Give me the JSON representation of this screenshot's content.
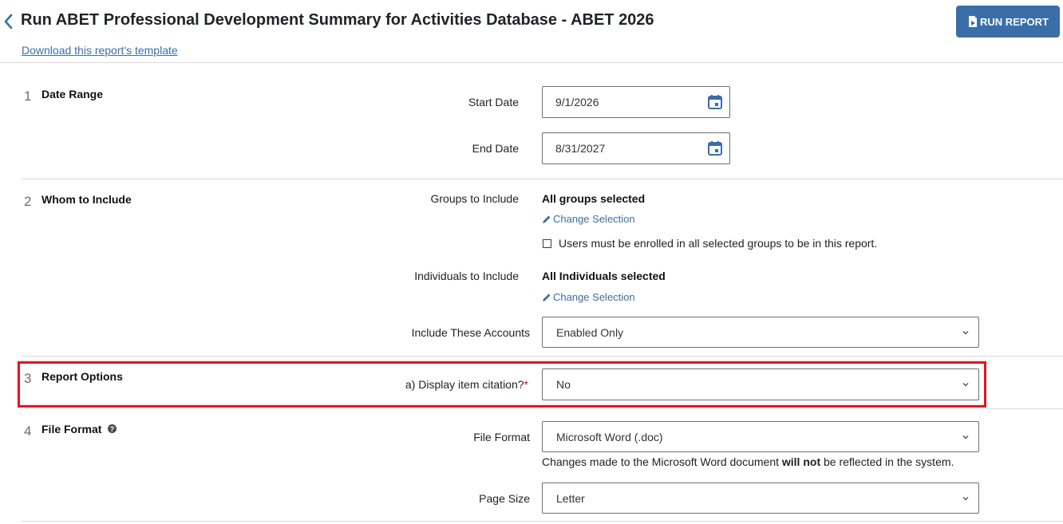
{
  "header": {
    "title": "Run ABET Professional Development Summary for Activities Database - ABET 2026",
    "template_link": "Download this report's template",
    "run_button": "RUN REPORT"
  },
  "sections": {
    "date_range": {
      "number": "1",
      "title": "Date Range",
      "start_label": "Start Date",
      "start_value": "9/1/2026",
      "end_label": "End Date",
      "end_value": "8/31/2027"
    },
    "whom": {
      "number": "2",
      "title": "Whom to Include",
      "groups_label": "Groups to Include",
      "groups_value": "All groups selected",
      "change_selection": "Change Selection",
      "enrolled_checkbox_label": "Users must be enrolled in all selected groups to be in this report.",
      "enrolled_checked": false,
      "individuals_label": "Individuals to Include",
      "individuals_value": "All Individuals selected",
      "accounts_label": "Include These Accounts",
      "accounts_value": "Enabled Only"
    },
    "report_options": {
      "number": "3",
      "title": "Report Options",
      "citation_label": "a) Display item citation?",
      "required_mark": "*",
      "citation_value": "No"
    },
    "file_format": {
      "number": "4",
      "title": "File Format",
      "format_label": "File Format",
      "format_value": "Microsoft Word (.doc)",
      "note_before": "Changes made to the Microsoft Word document ",
      "note_bold": "will not",
      "note_after": " be reflected in the system.",
      "page_size_label": "Page Size",
      "page_size_value": "Letter"
    }
  },
  "colors": {
    "accent": "#3a6ea8",
    "link": "#3a6fa8",
    "highlight": "#e0141e",
    "required": "#c8102e"
  },
  "icons": [
    "chevron-left-icon",
    "report-run-icon",
    "calendar-icon",
    "pencil-icon",
    "chevron-down-icon",
    "question-circle-icon"
  ]
}
